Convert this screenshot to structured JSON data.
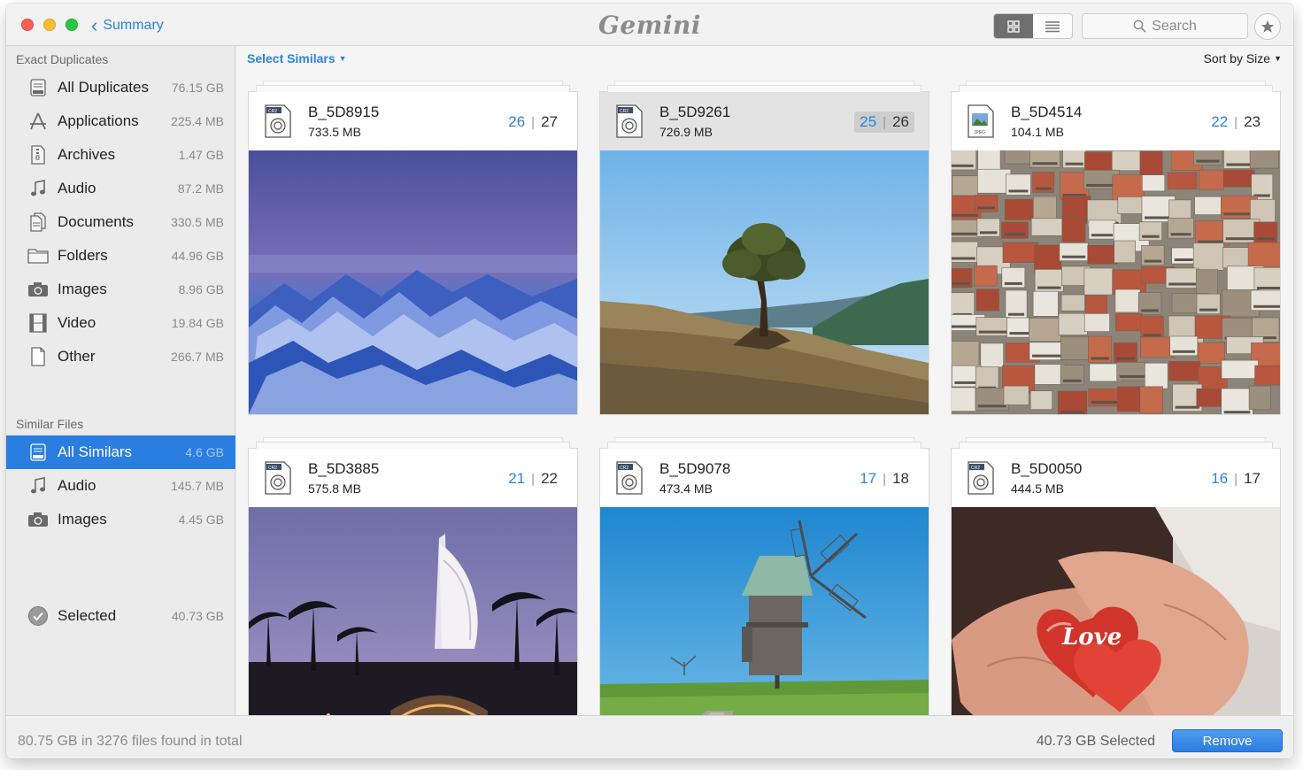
{
  "app": {
    "logo_text": "Gemini",
    "back_label": "Summary",
    "search_placeholder": "Search"
  },
  "sidebar": {
    "exact_title": "Exact Duplicates",
    "exact_items": [
      {
        "label": "All Duplicates",
        "size": "76.15 GB",
        "icon": "drive-icon"
      },
      {
        "label": "Applications",
        "size": "225.4 MB",
        "icon": "applications-icon"
      },
      {
        "label": "Archives",
        "size": "1.47 GB",
        "icon": "archive-icon"
      },
      {
        "label": "Audio",
        "size": "87.2 MB",
        "icon": "music-note-icon"
      },
      {
        "label": "Documents",
        "size": "330.5 MB",
        "icon": "documents-icon"
      },
      {
        "label": "Folders",
        "size": "44.96 GB",
        "icon": "folder-icon"
      },
      {
        "label": "Images",
        "size": "8.96 GB",
        "icon": "camera-icon"
      },
      {
        "label": "Video",
        "size": "19.84 GB",
        "icon": "film-icon"
      },
      {
        "label": "Other",
        "size": "266.7 MB",
        "icon": "file-icon"
      }
    ],
    "similar_title": "Similar Files",
    "similar_items": [
      {
        "label": "All Similars",
        "size": "4.6 GB",
        "icon": "drive-icon",
        "selected": true
      },
      {
        "label": "Audio",
        "size": "145.7 MB",
        "icon": "music-note-icon"
      },
      {
        "label": "Images",
        "size": "4.45 GB",
        "icon": "camera-icon"
      }
    ],
    "selected_item": {
      "label": "Selected",
      "size": "40.73 GB",
      "icon": "checkmark-circle-icon"
    }
  },
  "main": {
    "select_similars_label": "Select Similars",
    "sort_label": "Sort by Size",
    "cards": [
      {
        "name": "B_5D8915",
        "size": "733.5 MB",
        "count_a": "26",
        "count_b": "27",
        "file_type": "CR2",
        "photo": "snowy-mountains-aerial"
      },
      {
        "name": "B_5D9261",
        "size": "726.9 MB",
        "count_a": "25",
        "count_b": "26",
        "file_type": "CR2",
        "photo": "lone-tree-hillside",
        "selected": true
      },
      {
        "name": "B_5D4514",
        "size": "104.1 MB",
        "count_a": "22",
        "count_b": "23",
        "file_type": "JPEG",
        "photo": "city-rooftops"
      },
      {
        "name": "B_5D3885",
        "size": "575.8 MB",
        "count_a": "21",
        "count_b": "22",
        "file_type": "CR2",
        "photo": "burj-al-arab-night"
      },
      {
        "name": "B_5D9078",
        "size": "473.4 MB",
        "count_a": "17",
        "count_b": "18",
        "file_type": "CR2",
        "photo": "windmill-meadow"
      },
      {
        "name": "B_5D0050",
        "size": "444.5 MB",
        "count_a": "16",
        "count_b": "17",
        "file_type": "CR2",
        "photo": "hands-heart-love"
      }
    ]
  },
  "footer": {
    "summary": "80.75 GB in 3276 files found in total",
    "selected_summary": "40.73 GB Selected",
    "remove_label": "Remove"
  },
  "colors": {
    "accent": "#2a7de1",
    "link": "#2c84d8"
  }
}
